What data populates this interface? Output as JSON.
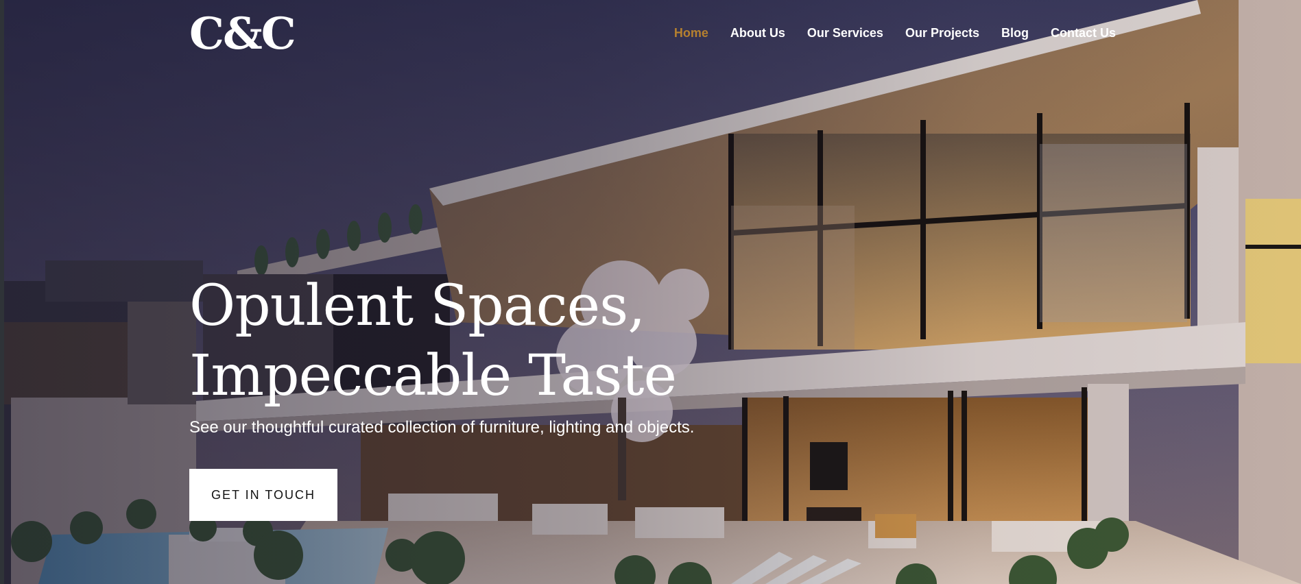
{
  "brand": {
    "logo_text": "C&C"
  },
  "nav": {
    "items": [
      {
        "label": "Home",
        "active": true
      },
      {
        "label": "About Us",
        "active": false
      },
      {
        "label": "Our Services",
        "active": false
      },
      {
        "label": "Our Projects",
        "active": false
      },
      {
        "label": "Blog",
        "active": false
      },
      {
        "label": "Contact Us",
        "active": false
      }
    ]
  },
  "hero": {
    "title_line_1": "Opulent Spaces,",
    "title_line_2": "Impeccable Taste",
    "subtitle": "See our thoughtful curated collection of furniture, lighting and objects.",
    "cta_label": "GET IN TOUCH"
  },
  "colors": {
    "accent": "#b5802f",
    "text_on_image": "#ffffff",
    "button_background": "#ffffff",
    "button_text": "#111111"
  }
}
